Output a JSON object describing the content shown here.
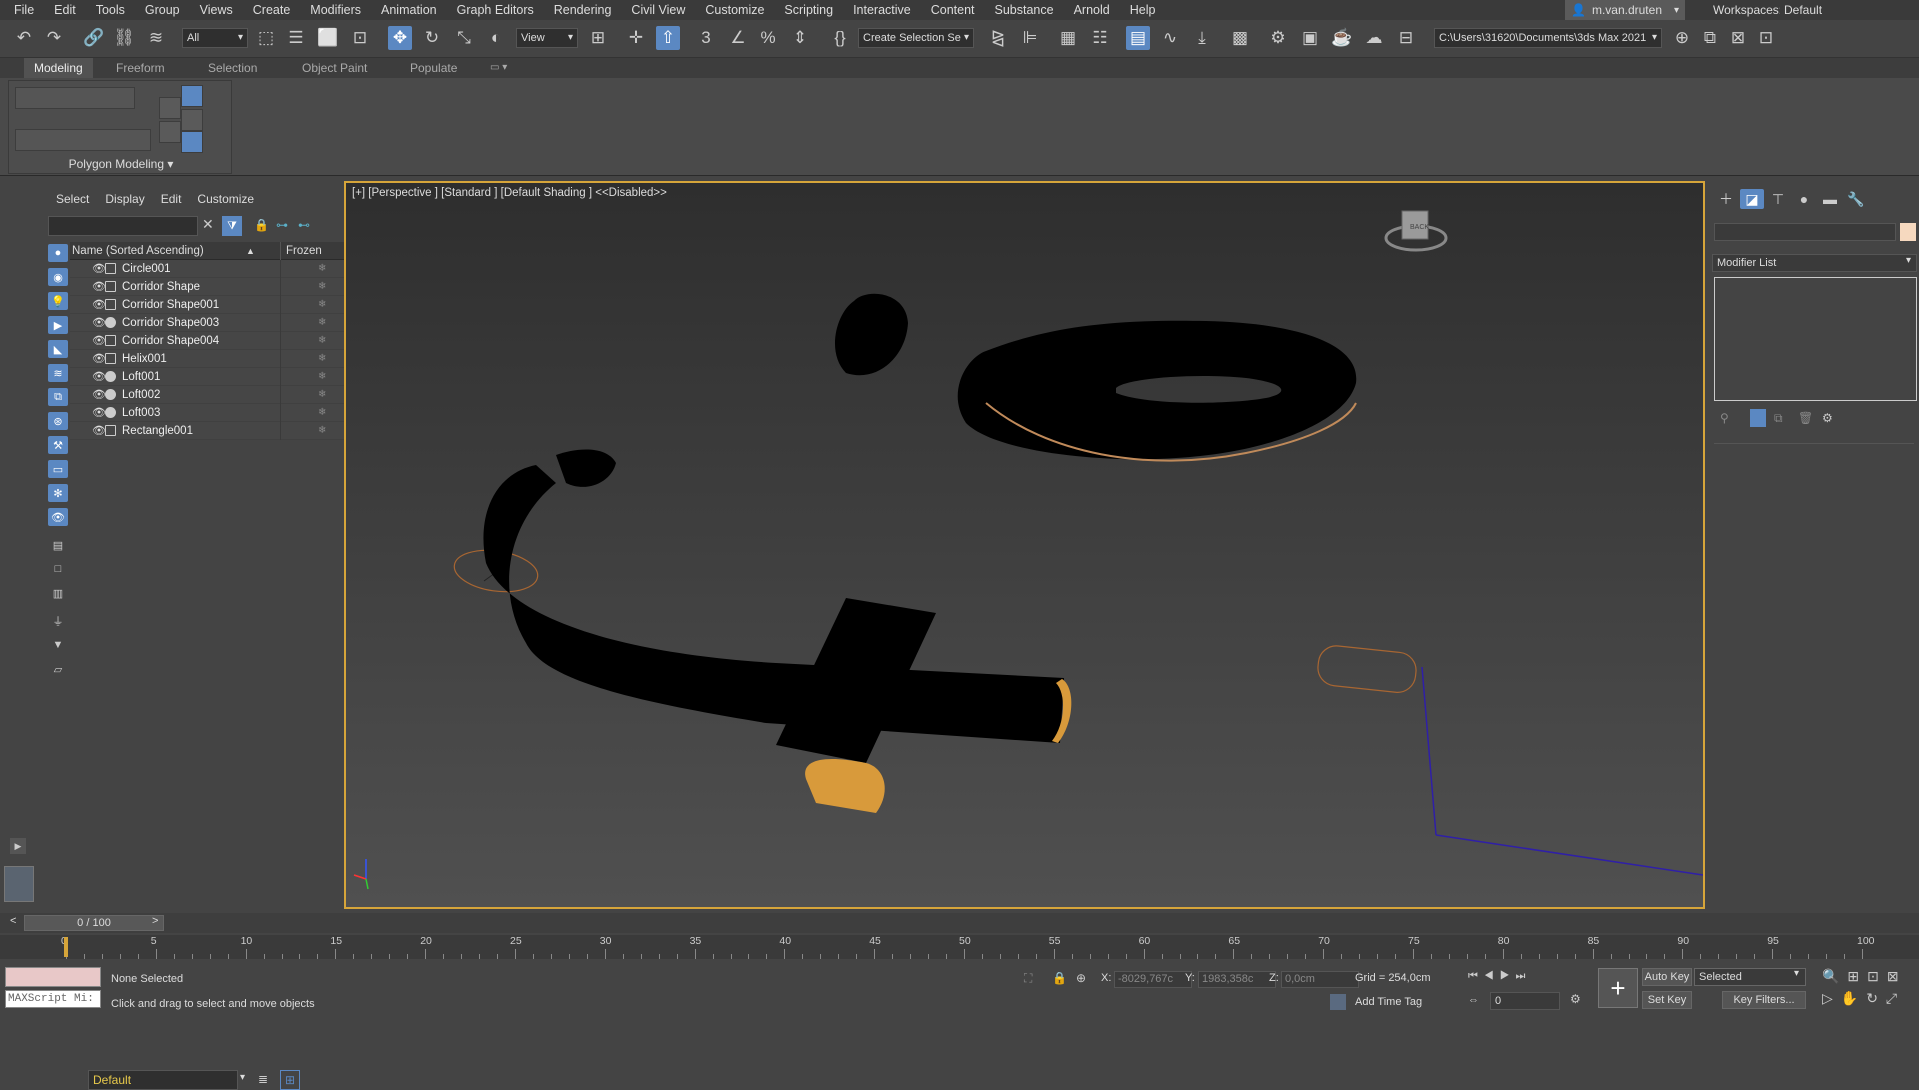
{
  "menus": [
    "File",
    "Edit",
    "Tools",
    "Group",
    "Views",
    "Create",
    "Modifiers",
    "Animation",
    "Graph Editors",
    "Rendering",
    "Civil View",
    "Customize",
    "Scripting",
    "Interactive",
    "Content",
    "Substance",
    "Arnold",
    "Help"
  ],
  "user": "m.van.druten",
  "workspaces_label": "Workspaces:",
  "workspace_value": "Default",
  "toolbar": {
    "filter_value": "All",
    "coord_system": "View",
    "selection_set": "Create Selection Se",
    "project_path": "C:\\Users\\31620\\Documents\\3ds Max 2021"
  },
  "ribbon_tabs": [
    "Modeling",
    "Freeform",
    "Selection",
    "Object Paint",
    "Populate"
  ],
  "ribbon_panel_label": "Polygon Modeling",
  "explorer": {
    "menus": [
      "Select",
      "Display",
      "Edit",
      "Customize"
    ],
    "col_name": "Name (Sorted Ascending)",
    "col_frozen": "Frozen",
    "items": [
      {
        "name": "Circle001",
        "kind": "shape"
      },
      {
        "name": "Corridor Shape",
        "kind": "shape"
      },
      {
        "name": "Corridor Shape001",
        "kind": "shape"
      },
      {
        "name": "Corridor Shape003",
        "kind": "geo"
      },
      {
        "name": "Corridor Shape004",
        "kind": "shape"
      },
      {
        "name": "Helix001",
        "kind": "shape"
      },
      {
        "name": "Loft001",
        "kind": "geo"
      },
      {
        "name": "Loft002",
        "kind": "geo"
      },
      {
        "name": "Loft003",
        "kind": "geo"
      },
      {
        "name": "Rectangle001",
        "kind": "shape"
      }
    ],
    "layer": "Default"
  },
  "viewport": {
    "label": "[+] [Perspective ] [Standard ] [Default Shading ]  <<Disabled>>"
  },
  "command_panel": {
    "modifier_list": "Modifier List"
  },
  "timeline": {
    "slider_text": "0 / 100",
    "ticks": [
      0,
      5,
      10,
      15,
      20,
      25,
      30,
      35,
      40,
      45,
      50,
      55,
      60,
      65,
      70,
      75,
      80,
      85,
      90,
      95,
      100
    ]
  },
  "status": {
    "selection": "None Selected",
    "prompt": "Click and drag to select and move objects",
    "maxscript": "MAXScript Mi:",
    "x_label": "X:",
    "x_value": "-8029,767c",
    "y_label": "Y:",
    "y_value": "1983,358c",
    "z_label": "Z:",
    "z_value": "0,0cm",
    "grid": "Grid = 254,0cm",
    "add_time_tag": "Add Time Tag",
    "auto_key": "Auto Key",
    "set_key": "Set Key",
    "selected": "Selected",
    "key_filters": "Key Filters...",
    "frame": "0"
  }
}
